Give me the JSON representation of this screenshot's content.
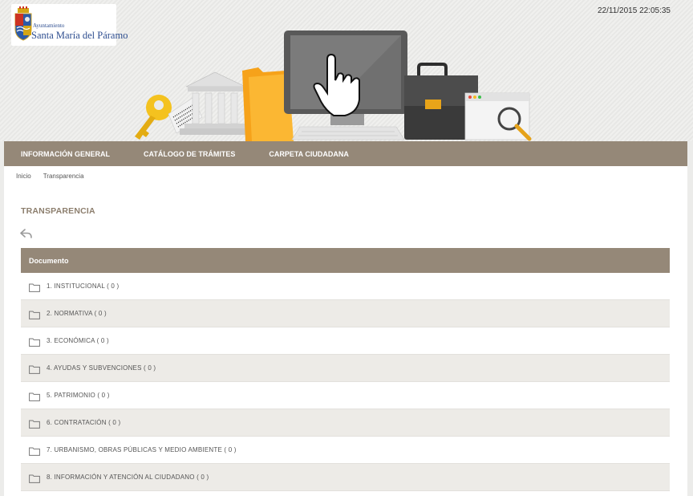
{
  "header": {
    "logo": {
      "line1": "Ayuntamiento",
      "line2": "Santa María del Páramo"
    },
    "datetime": "22/11/2015 22:05:35"
  },
  "nav": [
    {
      "label": "INFORMACIÓN GENERAL"
    },
    {
      "label": "CATÁLOGO DE TRÁMITES"
    },
    {
      "label": "CARPETA CIUDADANA"
    }
  ],
  "breadcrumb": [
    {
      "label": "Inicio"
    },
    {
      "label": "Transparencia"
    }
  ],
  "page": {
    "title": "TRANSPARENCIA",
    "back_icon": "back-arrow-icon"
  },
  "table": {
    "header": "Documento",
    "row_icon": "folder-icon",
    "rows": [
      {
        "label": "1. INSTITUCIONAL ( 0 )"
      },
      {
        "label": "2. NORMATIVA ( 0 )"
      },
      {
        "label": "3. ECONÓMICA ( 0 )"
      },
      {
        "label": "4. AYUDAS Y SUBVENCIONES ( 0 )"
      },
      {
        "label": "5. PATRIMONIO ( 0 )"
      },
      {
        "label": "6. CONTRATACIÓN ( 0 )"
      },
      {
        "label": "7. URBANISMO, OBRAS PÚBLICAS Y MEDIO AMBIENTE ( 0 )"
      },
      {
        "label": "8. INFORMACIÓN Y ATENCIÓN AL CIUDADANO ( 0 )"
      }
    ]
  },
  "colors": {
    "accent": "#958878",
    "title": "#8c7e6d",
    "row_alt": "#edebe7",
    "logo_text": "#2d4d8f"
  }
}
